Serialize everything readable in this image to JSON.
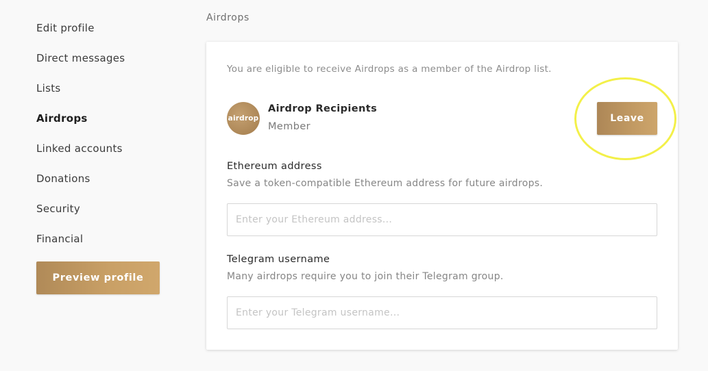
{
  "sidebar": {
    "items": [
      {
        "label": "Edit profile"
      },
      {
        "label": "Direct messages"
      },
      {
        "label": "Lists"
      },
      {
        "label": "Airdrops"
      },
      {
        "label": "Linked accounts"
      },
      {
        "label": "Donations"
      },
      {
        "label": "Security"
      },
      {
        "label": "Financial"
      }
    ],
    "active": "Airdrops",
    "preview_button": "Preview profile"
  },
  "main": {
    "heading": "Airdrops",
    "card": {
      "intro": "You are eligible to receive Airdrops as a member of the Airdrop list.",
      "group": {
        "avatar_text": "airdrop",
        "name": "Airdrop Recipients",
        "role": "Member",
        "leave_button": "Leave"
      },
      "ethereum": {
        "label": "Ethereum address",
        "help": "Save a token-compatible Ethereum address for future airdrops.",
        "placeholder": "Enter your Ethereum address...",
        "value": ""
      },
      "telegram": {
        "label": "Telegram username",
        "help": "Many airdrops require you to join their Telegram group.",
        "placeholder": "Enter your Telegram username...",
        "value": ""
      }
    }
  },
  "colors": {
    "accent": "#c29a63",
    "highlight": "#f3f049"
  }
}
